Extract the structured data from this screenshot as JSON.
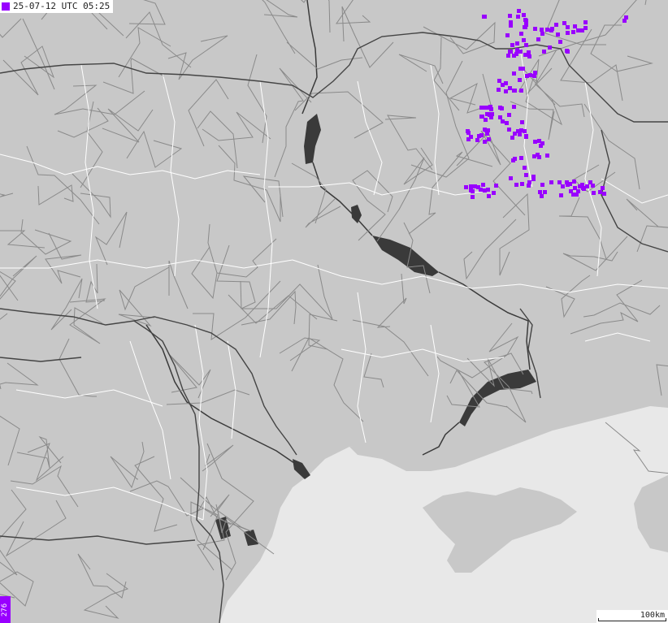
{
  "map": {
    "timestamp": "25-07-12 UTC 05:25",
    "strike_count": "276",
    "scale_label": "100km",
    "colors": {
      "land": "#c8c8c8",
      "sea": "#e8e8e8",
      "water": "#3a3a3a",
      "road": "#8a8a8a",
      "national_border": "#444444",
      "regional_border": "#ffffff",
      "strike": "#9900ff"
    }
  }
}
